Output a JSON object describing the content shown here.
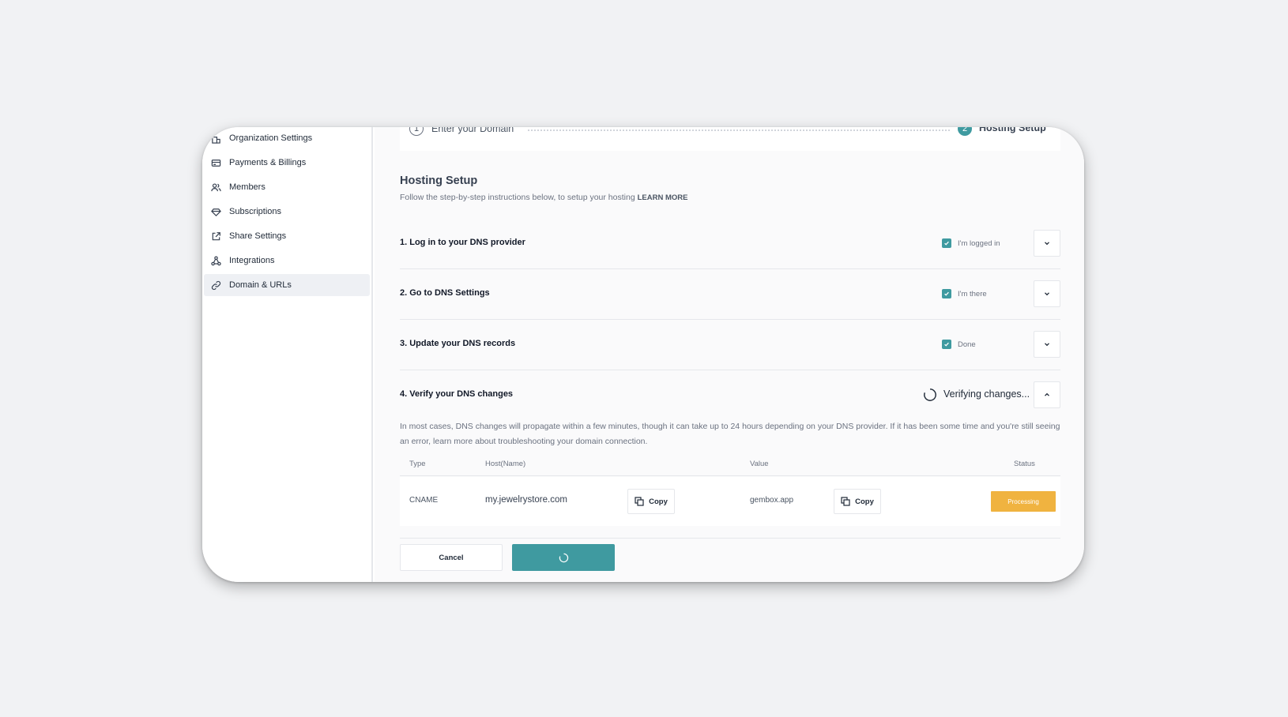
{
  "sidebar": {
    "items": [
      {
        "label": "Organization Settings",
        "icon": "building-icon",
        "active": false
      },
      {
        "label": "Payments & Billings",
        "icon": "credit-card-icon",
        "active": false
      },
      {
        "label": "Members",
        "icon": "users-icon",
        "active": false
      },
      {
        "label": "Subscriptions",
        "icon": "diamond-icon",
        "active": false
      },
      {
        "label": "Share Settings",
        "icon": "external-link-icon",
        "active": false
      },
      {
        "label": "Integrations",
        "icon": "integrations-icon",
        "active": false
      },
      {
        "label": "Domain & URLs",
        "icon": "link-icon",
        "active": true
      }
    ]
  },
  "stepper": {
    "step1_number": "1",
    "step1_label": "Enter your Domain",
    "step2_number": "2",
    "step2_label": "Hosting Setup"
  },
  "header": {
    "title": "Hosting Setup",
    "subtitle": "Follow the step-by-step instructions below, to setup your hosting",
    "learn_more": "LEARN MORE"
  },
  "steps": [
    {
      "title": "1. Log in to your DNS provider",
      "check_label": "I'm logged in",
      "checked": true
    },
    {
      "title": "2. Go to DNS Settings",
      "check_label": "I'm there",
      "checked": true
    },
    {
      "title": "3. Update your DNS records",
      "check_label": "Done",
      "checked": true
    },
    {
      "title": "4. Verify your DNS changes",
      "status_label": "Verifying changes..."
    }
  ],
  "verify": {
    "description": "In most cases, DNS changes will propagate within a few minutes, though it can take up to 24 hours depending on your DNS provider. If it has been some time and you're still seeing an error, learn more about troubleshooting your domain connection."
  },
  "table": {
    "headers": {
      "type": "Type",
      "host": "Host(Name)",
      "value": "Value",
      "status": "Status"
    },
    "rows": [
      {
        "type": "CNAME",
        "host": "my.jewelrystore.com",
        "value": "gembox.app",
        "status": "Processing",
        "copy_label": "Copy"
      }
    ]
  },
  "footer": {
    "cancel_label": "Cancel"
  },
  "colors": {
    "accent": "#3f9aa0",
    "processing": "#f0b340"
  }
}
